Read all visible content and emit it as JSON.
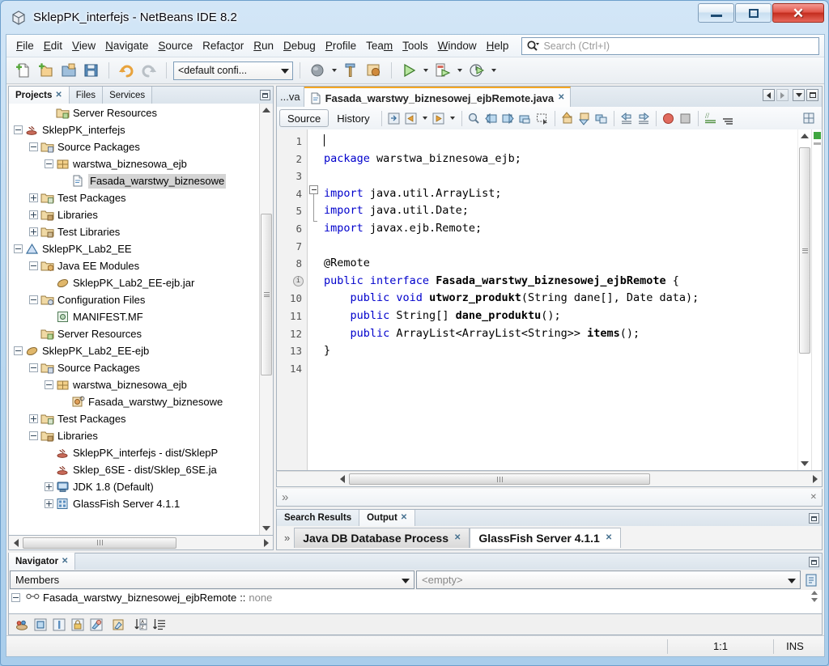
{
  "window": {
    "title": "SklepPK_interfejs - NetBeans IDE 8.2",
    "icon": "netbeans-cube-icon",
    "buttons": {
      "minimize": "minimize-button",
      "maximize": "maximize-button",
      "close": "close-button"
    }
  },
  "menubar": {
    "items": [
      {
        "label": "File",
        "mnemonic": "F"
      },
      {
        "label": "Edit",
        "mnemonic": "E"
      },
      {
        "label": "View",
        "mnemonic": "V"
      },
      {
        "label": "Navigate",
        "mnemonic": "N"
      },
      {
        "label": "Source",
        "mnemonic": "S"
      },
      {
        "label": "Refactor",
        "mnemonic": "R"
      },
      {
        "label": "Run",
        "mnemonic": "R"
      },
      {
        "label": "Debug",
        "mnemonic": "D"
      },
      {
        "label": "Profile",
        "mnemonic": "P"
      },
      {
        "label": "Team",
        "mnemonic": "m"
      },
      {
        "label": "Tools",
        "mnemonic": "T"
      },
      {
        "label": "Window",
        "mnemonic": "W"
      },
      {
        "label": "Help",
        "mnemonic": "H"
      }
    ]
  },
  "search": {
    "placeholder": "Search (Ctrl+I)",
    "value": "",
    "icon": "search-icon"
  },
  "toolbar": {
    "config_combo": "<default confi...",
    "buttons": [
      "new-file-icon",
      "new-project-icon",
      "open-project-icon",
      "save-all-icon",
      "undo-icon",
      "redo-icon",
      "build-project-icon",
      "clean-build-icon",
      "run-project-icon",
      "debug-project-icon",
      "profile-project-icon"
    ]
  },
  "left_panel": {
    "tabs": [
      {
        "label": "Projects",
        "active": true,
        "closable": true
      },
      {
        "label": "Files",
        "active": false,
        "closable": false
      },
      {
        "label": "Services",
        "active": false,
        "closable": false
      }
    ],
    "minimize": "minimize-window-button",
    "tree": [
      {
        "label": "Server Resources",
        "indent": 2,
        "toggle": "none",
        "icon": "server-resources-folder-icon",
        "selected": false
      },
      {
        "label": "SklepPK_interfejs",
        "indent": 0,
        "toggle": "minus",
        "icon": "java-project-icon",
        "selected": false
      },
      {
        "label": "Source Packages",
        "indent": 1,
        "toggle": "minus",
        "icon": "source-packages-folder-icon",
        "selected": false
      },
      {
        "label": "warstwa_biznesowa_ejb",
        "indent": 2,
        "toggle": "minus",
        "icon": "package-icon",
        "selected": false
      },
      {
        "label": "Fasada_warstwy_biznesowe",
        "indent": 3,
        "toggle": "none",
        "icon": "java-interface-file-icon",
        "selected": true
      },
      {
        "label": "Test Packages",
        "indent": 1,
        "toggle": "plus",
        "icon": "test-packages-folder-icon",
        "selected": false
      },
      {
        "label": "Libraries",
        "indent": 1,
        "toggle": "plus",
        "icon": "libraries-folder-icon",
        "selected": false
      },
      {
        "label": "Test Libraries",
        "indent": 1,
        "toggle": "plus",
        "icon": "test-libraries-folder-icon",
        "selected": false
      },
      {
        "label": "SklepPK_Lab2_EE",
        "indent": 0,
        "toggle": "minus",
        "icon": "enterprise-app-icon",
        "selected": false
      },
      {
        "label": "Java EE Modules",
        "indent": 1,
        "toggle": "minus",
        "icon": "java-ee-modules-folder-icon",
        "selected": false
      },
      {
        "label": "SklepPK_Lab2_EE-ejb.jar",
        "indent": 2,
        "toggle": "none",
        "icon": "jar-icon",
        "selected": false
      },
      {
        "label": "Configuration Files",
        "indent": 1,
        "toggle": "minus",
        "icon": "config-files-folder-icon",
        "selected": false
      },
      {
        "label": "MANIFEST.MF",
        "indent": 2,
        "toggle": "none",
        "icon": "manifest-file-icon",
        "selected": false
      },
      {
        "label": "Server Resources",
        "indent": 1,
        "toggle": "none",
        "icon": "server-resources-folder-icon",
        "selected": false
      },
      {
        "label": "SklepPK_Lab2_EE-ejb",
        "indent": 0,
        "toggle": "minus",
        "icon": "ejb-project-icon",
        "selected": false
      },
      {
        "label": "Source Packages",
        "indent": 1,
        "toggle": "minus",
        "icon": "source-packages-folder-icon",
        "selected": false
      },
      {
        "label": "warstwa_biznesowa_ejb",
        "indent": 2,
        "toggle": "minus",
        "icon": "package-icon",
        "selected": false
      },
      {
        "label": "Fasada_warstwy_biznesowe",
        "indent": 3,
        "toggle": "none",
        "icon": "ejb-bean-file-icon",
        "selected": false
      },
      {
        "label": "Test Packages",
        "indent": 1,
        "toggle": "plus",
        "icon": "test-packages-folder-icon",
        "selected": false
      },
      {
        "label": "Libraries",
        "indent": 1,
        "toggle": "minus",
        "icon": "libraries-folder-icon",
        "selected": false
      },
      {
        "label": "SklepPK_interfejs - dist/SklepP",
        "indent": 2,
        "toggle": "none",
        "icon": "java-project-icon",
        "selected": false
      },
      {
        "label": "Sklep_6SE - dist/Sklep_6SE.ja",
        "indent": 2,
        "toggle": "none",
        "icon": "java-project-icon",
        "selected": false
      },
      {
        "label": "JDK 1.8 (Default)",
        "indent": 2,
        "toggle": "plus",
        "icon": "jdk-platform-icon",
        "selected": false
      },
      {
        "label": "GlassFish Server 4.1.1",
        "indent": 2,
        "toggle": "plus",
        "icon": "glassfish-server-icon",
        "selected": false
      }
    ]
  },
  "editor": {
    "tabs": [
      {
        "label": "...va",
        "active": false,
        "truncated": true,
        "closable": false
      },
      {
        "label": "Fasada_warstwy_biznesowej_ejbRemote.java",
        "active": true,
        "truncated": false,
        "closable": true
      }
    ],
    "nav_buttons": [
      "scroll-tabs-left-button",
      "scroll-tabs-right-button",
      "tab-list-button",
      "maximize-editor-button"
    ],
    "view_tabs": [
      {
        "label": "Source",
        "active": true
      },
      {
        "label": "History",
        "active": false
      }
    ],
    "toolbar_icons": [
      "last-edit-icon",
      "back-icon",
      "forward-icon",
      "find-selection-icon",
      "previous-bookmark-icon",
      "next-bookmark-icon",
      "toggle-bookmark-icon",
      "rectangular-selection-icon",
      "previous-error-icon",
      "next-error-icon",
      "toggle-highlight-icon",
      "shift-left-icon",
      "shift-right-icon",
      "start-macro-recording-icon",
      "stop-macro-recording-icon",
      "toggle-comment-icon",
      "inspect-icon",
      "split-editor-icon"
    ],
    "lines": [
      {
        "num": "1",
        "annot": null,
        "tokens": [
          {
            "t": "",
            "c": "plain"
          }
        ],
        "caret": true
      },
      {
        "num": "2",
        "annot": null,
        "tokens": [
          {
            "t": "package ",
            "c": "kw"
          },
          {
            "t": "warstwa_biznesowa_ejb;",
            "c": "plain"
          }
        ]
      },
      {
        "num": "3",
        "annot": null,
        "tokens": []
      },
      {
        "num": "4",
        "annot": null,
        "tokens": [
          {
            "t": "import ",
            "c": "kw"
          },
          {
            "t": "java.util.ArrayList;",
            "c": "plain"
          }
        ]
      },
      {
        "num": "5",
        "annot": null,
        "tokens": [
          {
            "t": "import ",
            "c": "kw"
          },
          {
            "t": "java.util.Date;",
            "c": "plain"
          }
        ]
      },
      {
        "num": "6",
        "annot": null,
        "tokens": [
          {
            "t": "import ",
            "c": "kw"
          },
          {
            "t": "javax.ejb.Remote;",
            "c": "plain"
          }
        ]
      },
      {
        "num": "7",
        "annot": null,
        "tokens": []
      },
      {
        "num": "8",
        "annot": null,
        "tokens": [
          {
            "t": "@Remote",
            "c": "plain"
          }
        ]
      },
      {
        "num": "9",
        "annot": "info",
        "tokens": [
          {
            "t": "public ",
            "c": "kw"
          },
          {
            "t": "interface ",
            "c": "kw"
          },
          {
            "t": "Fasada_warstwy_biznesowej_ejbRemote ",
            "c": "bold"
          },
          {
            "t": "{",
            "c": "plain"
          }
        ]
      },
      {
        "num": "10",
        "annot": null,
        "tokens": [
          {
            "t": "    ",
            "c": "plain"
          },
          {
            "t": "public ",
            "c": "kw"
          },
          {
            "t": "void ",
            "c": "kw"
          },
          {
            "t": "utworz_produkt",
            "c": "bold"
          },
          {
            "t": "(String dane[], Date data);",
            "c": "plain"
          }
        ]
      },
      {
        "num": "11",
        "annot": null,
        "tokens": [
          {
            "t": "    ",
            "c": "plain"
          },
          {
            "t": "public ",
            "c": "kw"
          },
          {
            "t": "String[] ",
            "c": "plain"
          },
          {
            "t": "dane_produktu",
            "c": "bold"
          },
          {
            "t": "();",
            "c": "plain"
          }
        ]
      },
      {
        "num": "12",
        "annot": null,
        "tokens": [
          {
            "t": "    ",
            "c": "plain"
          },
          {
            "t": "public ",
            "c": "kw"
          },
          {
            "t": "ArrayList<ArrayList<String>> ",
            "c": "plain"
          },
          {
            "t": "items",
            "c": "bold"
          },
          {
            "t": "();",
            "c": "plain"
          }
        ]
      },
      {
        "num": "13",
        "annot": null,
        "tokens": [
          {
            "t": "}",
            "c": "plain"
          }
        ]
      },
      {
        "num": "14",
        "annot": null,
        "tokens": []
      }
    ]
  },
  "inspector": {
    "chevron": "expand-chevron-icon",
    "close": "close-icon"
  },
  "output": {
    "tabs": [
      {
        "label": "Search Results",
        "active": false,
        "closable": false
      },
      {
        "label": "Output",
        "active": true,
        "closable": true
      }
    ],
    "minimize": "minimize-window-button",
    "chevron": "scroll-tabs-icon",
    "process_tabs": [
      {
        "label": "Java DB Database Process",
        "active": false,
        "closable": true
      },
      {
        "label": "GlassFish Server 4.1.1",
        "active": true,
        "closable": true
      }
    ]
  },
  "navigator": {
    "tab": {
      "label": "Navigator",
      "closable": true
    },
    "minimize": "minimize-window-button",
    "scope_combo": "Members",
    "filter_combo": "<empty>",
    "filter_button": "filter-list-button",
    "tree_item": {
      "name": "Fasada_warstwy_biznesowej_ejbRemote",
      "separator": "::",
      "value": "none",
      "icon": "interface-icon",
      "toggle": "minus"
    },
    "toolbar_buttons": [
      "show-inherited-members-icon",
      "show-public-icon",
      "show-protected-icon",
      "show-package-private-icon",
      "show-private-icon",
      "show-static-icon",
      "sort-alphabetically-icon",
      "sort-by-source-icon"
    ]
  },
  "statusbar": {
    "position": "1:1",
    "insert_mode": "INS"
  },
  "colors": {
    "keyword": "#0000cc",
    "accent_tab": "#f5a623",
    "selection": "#d4d4d4",
    "frame": "#a9cdeb",
    "close_button": "#c42d1e",
    "ok_marker": "#3fa63f"
  }
}
